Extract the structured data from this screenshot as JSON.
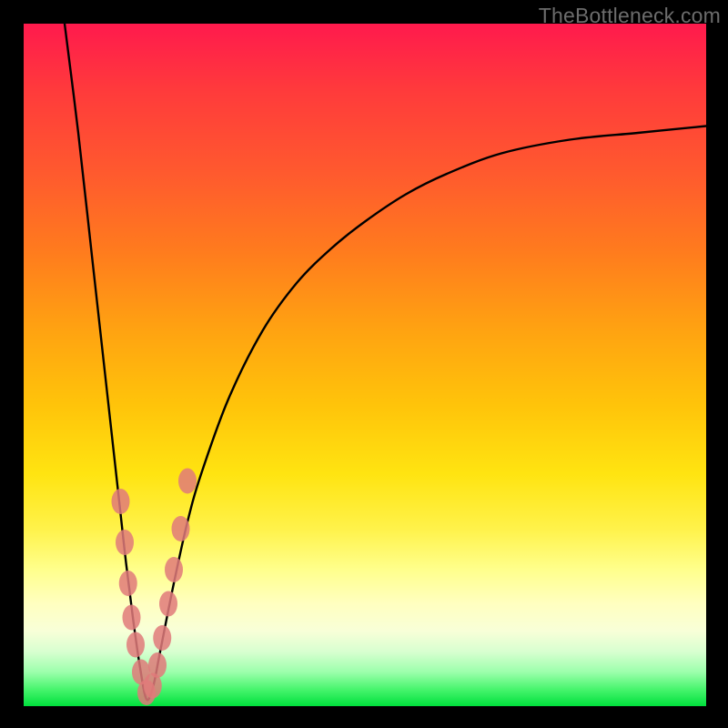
{
  "watermark": "TheBottleneck.com",
  "colors": {
    "top": "#ff1a4d",
    "mid": "#ffe411",
    "bottom": "#00e03c",
    "frame": "#000000",
    "curve": "#000000",
    "beads": "#e07a7a",
    "watermark": "#6c6c6c"
  },
  "chart_data": {
    "type": "line",
    "title": "",
    "xlabel": "",
    "ylabel": "",
    "x_range": [
      0,
      100
    ],
    "y_range": [
      0,
      100
    ],
    "notes": "Single V-shaped curve. Minimum (best, green zone) near x≈18, y≈0. Left branch rises steeply to y≈100 near x≈6; right branch rises with diminishing slope toward y≈85 at x≈100. Pink bead markers cluster on both branches between roughly y≈8 and y≈33 near the minimum.",
    "series": [
      {
        "name": "curve",
        "x": [
          6,
          8,
          10,
          12,
          14,
          15,
          16,
          17,
          18,
          19,
          20,
          22,
          24,
          26,
          30,
          35,
          40,
          45,
          50,
          56,
          62,
          70,
          80,
          90,
          100
        ],
        "y": [
          100,
          84,
          66,
          48,
          30,
          21,
          13,
          6,
          1,
          3,
          8,
          18,
          27,
          34,
          45,
          55,
          62,
          67,
          71,
          75,
          78,
          81,
          83,
          84,
          85
        ]
      }
    ],
    "beads": {
      "name": "markers-near-minimum",
      "points": [
        {
          "x": 14.2,
          "y": 30
        },
        {
          "x": 14.8,
          "y": 24
        },
        {
          "x": 15.3,
          "y": 18
        },
        {
          "x": 15.8,
          "y": 13
        },
        {
          "x": 16.4,
          "y": 9
        },
        {
          "x": 17.2,
          "y": 5
        },
        {
          "x": 18.0,
          "y": 2
        },
        {
          "x": 18.9,
          "y": 3
        },
        {
          "x": 19.6,
          "y": 6
        },
        {
          "x": 20.3,
          "y": 10
        },
        {
          "x": 21.2,
          "y": 15
        },
        {
          "x": 22.0,
          "y": 20
        },
        {
          "x": 23.0,
          "y": 26
        },
        {
          "x": 24.0,
          "y": 33
        }
      ]
    }
  }
}
